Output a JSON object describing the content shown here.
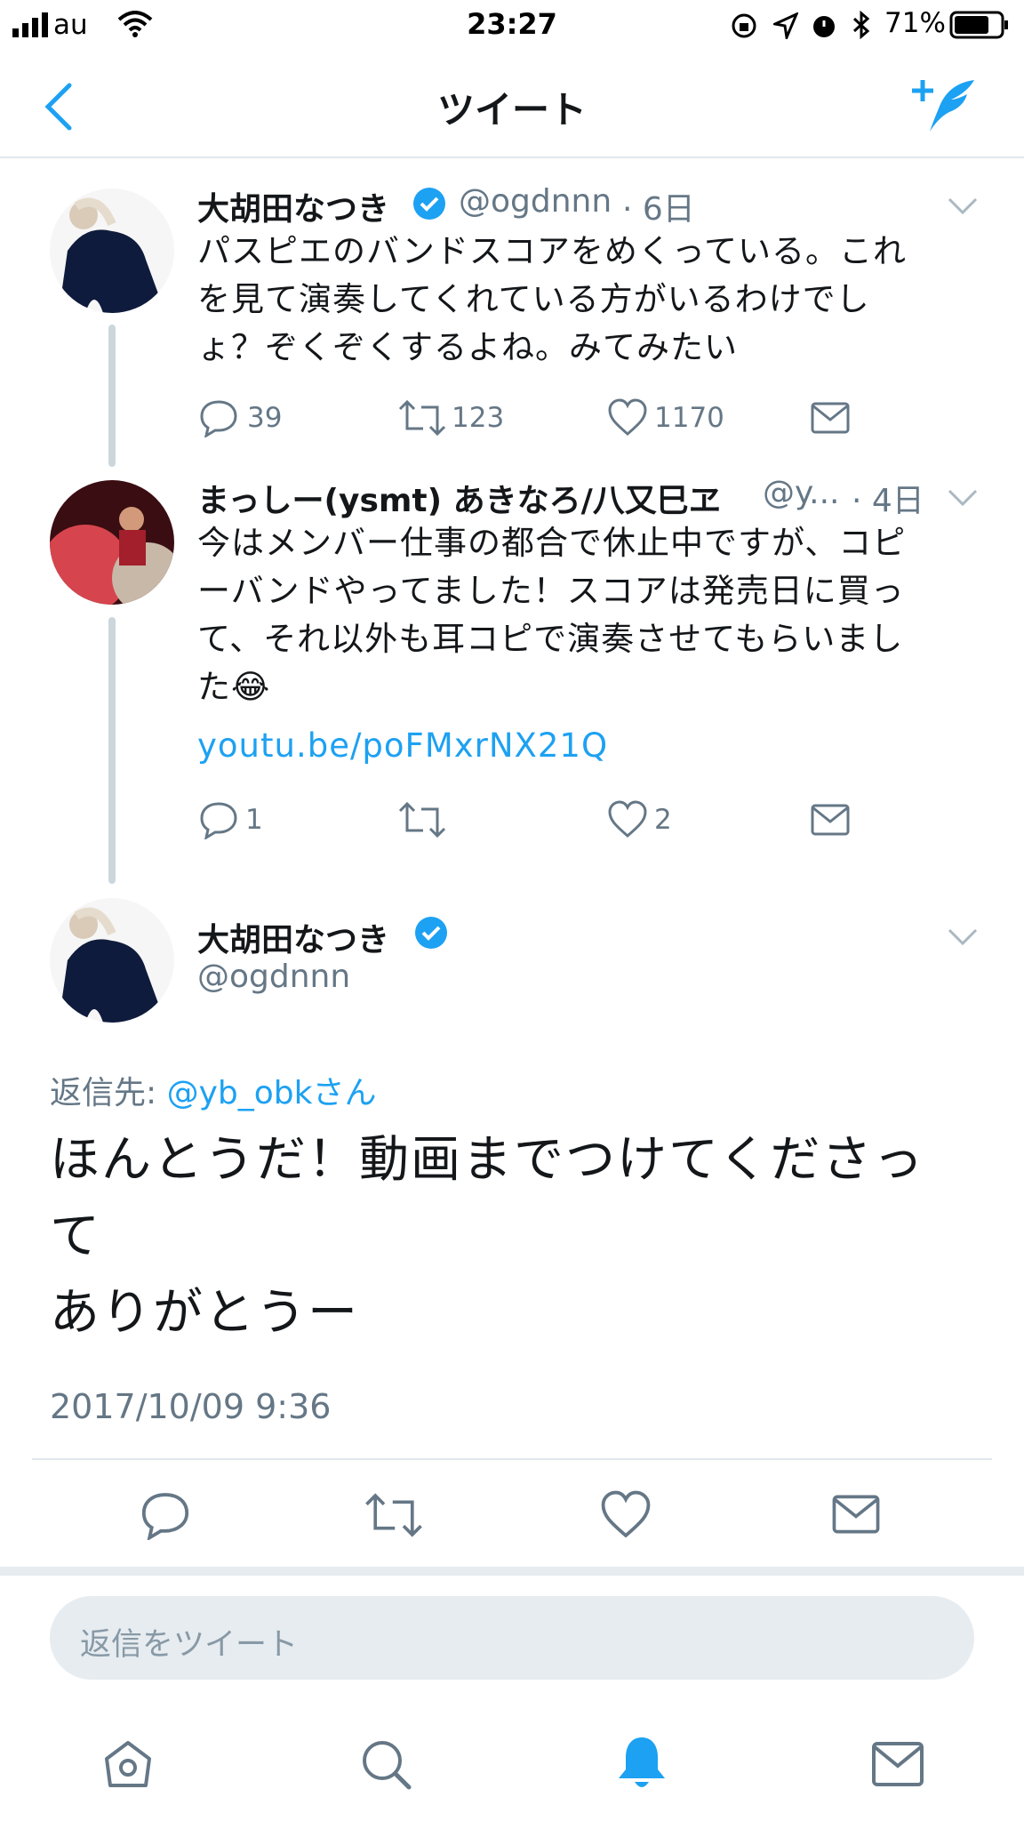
{
  "status_bar": {
    "carrier": "au",
    "time": "23:27",
    "battery": "71%"
  },
  "nav": {
    "title": "ツイート",
    "back_icon": "chevron-left-icon",
    "compose_icon": "compose-feather-icon"
  },
  "tweets": [
    {
      "name": "大胡田なつき",
      "handle": "@ogdnnn",
      "time": "· 6日",
      "text_lines": [
        "パスピエのバンドスコアをめくっている。これ",
        "を見て演奏してくれている方がいるわけでし",
        "ょ？ぞくぞくするよね。みてみたい"
      ],
      "replies": "39",
      "retweets": "123",
      "likes": "1170"
    },
    {
      "name": "まっしー(ysmt) あきなろ/八又巳ヱ",
      "handle": "@y...",
      "time": "· 4日",
      "text_lines": [
        "今はメンバー仕事の都合で休止中ですが、コピ",
        "ーバンドやってました！スコアは発売日に買っ",
        "て、それ以外も耳コピで演奏させてもらいまし",
        "た😂"
      ],
      "link": "youtu.be/poFMxrNX21Q",
      "replies": "1",
      "retweets": "",
      "likes": "2"
    }
  ],
  "main_tweet": {
    "name": "大胡田なつき",
    "handle": "@ogdnnn",
    "reply_to_label": "返信先: ",
    "reply_to_handle": "@yb_obkさん",
    "text_lines": [
      "ほんとうだ！動画までつけてくださっ",
      "て",
      "ありがとうー"
    ],
    "timestamp": "2017/10/09 9:36"
  },
  "reply_box": {
    "placeholder": "返信をツイート"
  },
  "tab_bar": {
    "items": [
      "home-icon",
      "search-icon",
      "notifications-bell-icon",
      "messages-envelope-icon"
    ],
    "active": "notifications-bell-icon"
  },
  "colors": {
    "accent": "#1da1f2",
    "secondary_text": "#657786",
    "divider": "#e1e8ed",
    "thread_line": "#ccd6dd"
  }
}
